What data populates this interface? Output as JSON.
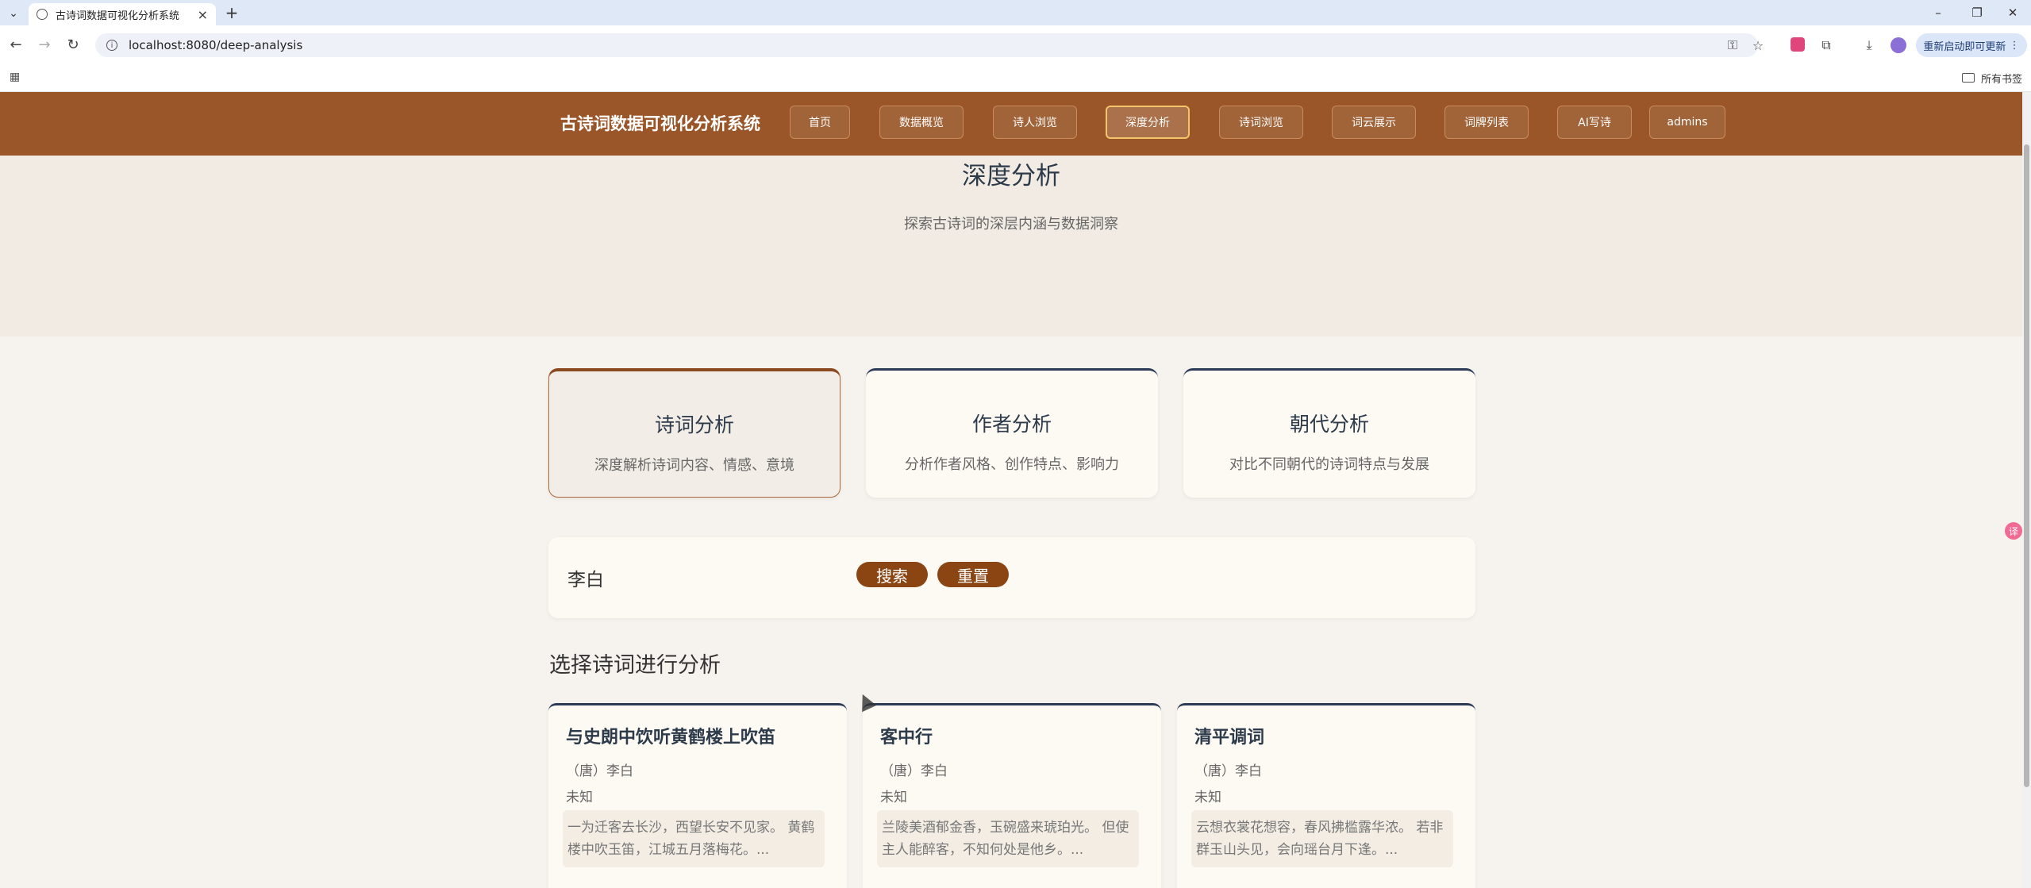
{
  "browser": {
    "tab_title": "古诗词数据可视化分析系统",
    "url": "localhost:8080/deep-analysis",
    "update_button": "重新启动即可更新",
    "bookmarks_all": "所有书签"
  },
  "header": {
    "site_title": "古诗词数据可视化分析系统",
    "nav": [
      {
        "label": "首页"
      },
      {
        "label": "数据概览"
      },
      {
        "label": "诗人浏览"
      },
      {
        "label": "深度分析",
        "active": true
      },
      {
        "label": "诗词浏览"
      },
      {
        "label": "词云展示"
      },
      {
        "label": "词牌列表"
      },
      {
        "label": "AI写诗"
      },
      {
        "label": "admins"
      }
    ]
  },
  "hero": {
    "title": "深度分析",
    "subtitle": "探索古诗词的深层内涵与数据洞察"
  },
  "analysis_types": [
    {
      "title": "诗词分析",
      "desc": "深度解析诗词内容、情感、意境",
      "active": true
    },
    {
      "title": "作者分析",
      "desc": "分析作者风格、创作特点、影响力"
    },
    {
      "title": "朝代分析",
      "desc": "对比不同朝代的诗词特点与发展"
    }
  ],
  "search": {
    "value": "李白",
    "search_label": "搜索",
    "reset_label": "重置"
  },
  "poems_section": {
    "title": "选择诗词进行分析",
    "poems": [
      {
        "title": "与史朗中饮听黄鹤楼上吹笛",
        "author": "（唐）李白",
        "date": "未知",
        "content": "一为迁客去长沙，西望长安不见家。 黄鹤楼中吹玉笛，江城五月落梅花。..."
      },
      {
        "title": "客中行",
        "author": "（唐）李白",
        "date": "未知",
        "content": "兰陵美酒郁金香，玉碗盛来琥珀光。 但使主人能醉客，不知何处是他乡。..."
      },
      {
        "title": "清平调词",
        "author": "（唐）李白",
        "date": "未知",
        "content": "云想衣裳花想容，春风拂槛露华浓。 若非群玉山头见，会向瑶台月下逢。..."
      }
    ]
  },
  "colors": {
    "header_bg": "#9a5628",
    "accent": "#8b4513",
    "page_bg": "#f6f3ee"
  }
}
